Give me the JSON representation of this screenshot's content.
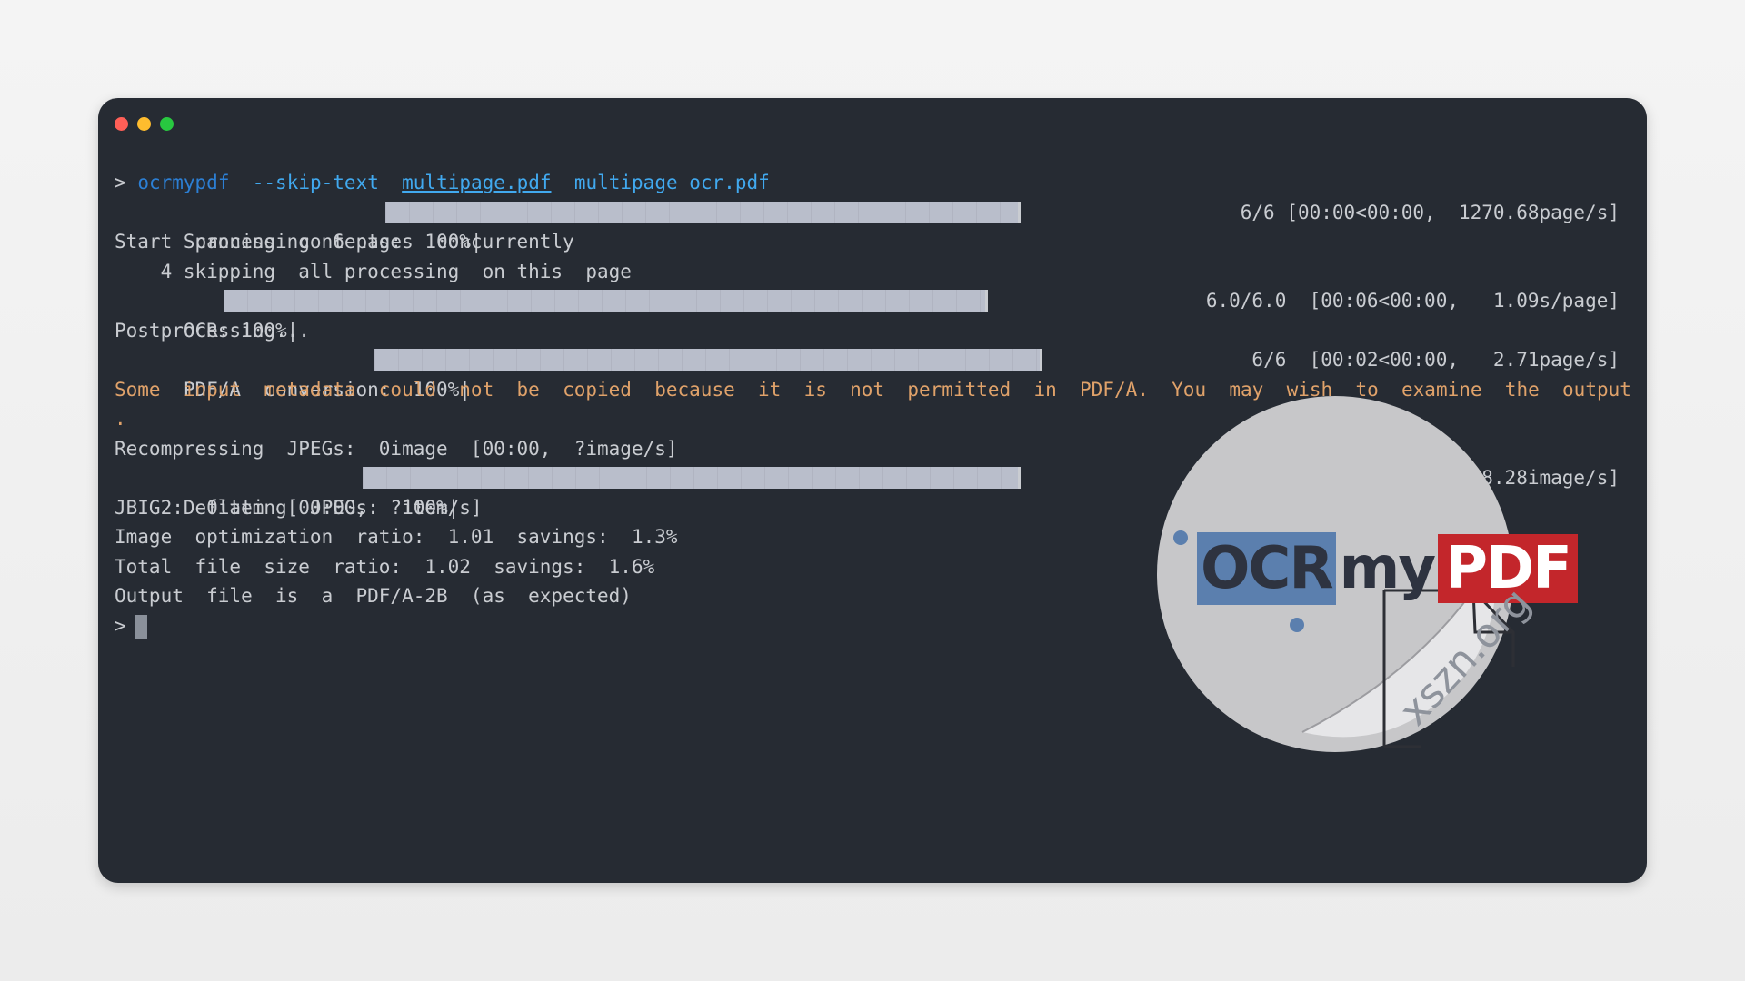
{
  "terminal": {
    "command": {
      "prompt": ">",
      "program": "ocrmypdf",
      "flag": "--skip-text",
      "input_file": "multipage.pdf",
      "output_file": "multipage_ocr.pdf"
    },
    "scan": {
      "label": "Scanning  contents:  100%|",
      "stats": "6/6 [00:00<00:00,  1270.68page/s]",
      "progress": 1.0
    },
    "start_processing": "Start  processing  6 pages  concurrently",
    "skipping": "    4 skipping  all processing  on this  page",
    "ocr": {
      "label": "OCR: 100%|",
      "stats": "6.0/6.0  [00:06<00:00,   1.09s/page]",
      "progress": 1.0
    },
    "postprocessing": "Postprocessing...",
    "pdfa": {
      "label": "PDF/A  conversion:  100%|",
      "stats": "6/6  [00:02<00:00,   2.71page/s]",
      "progress": 1.0
    },
    "warning": "Some  input  metadata  could  not  be  copied  because  it  is  not  permitted  in  PDF/A.  You  may  wish  to  examine  the  output  PDF's  XMP  metadata",
    "warning_cont": ".",
    "recompress": "Recompressing  JPEGs:  0image  [00:00,  ?image/s]",
    "deflate": {
      "label": "Deflating  JPEGs:  100%|",
      "stats": "4/4 [00:00<00:00,  238.28image/s]",
      "progress": 1.0
    },
    "jbig2": "JBIG2:  0item  [00:00,  ?item/s]",
    "image_opt": "Image  optimization  ratio:  1.01  savings:  1.3%",
    "total": "Total  file  size  ratio:  1.02  savings:  1.6%",
    "output": "Output  file  is  a  PDF/A-2B  (as  expected)",
    "final_prompt": ">"
  },
  "logo": {
    "part_ocr": "OCR",
    "part_my": "my",
    "part_pdf": "PDF"
  },
  "watermark": "xszn.org",
  "colors": {
    "window_bg": "#262b33",
    "text": "#c9ccd1",
    "command": "#2c7fd4",
    "argument": "#41a9ef",
    "warning": "#e0a26a",
    "logo_pdf_red": "#c3262b"
  }
}
